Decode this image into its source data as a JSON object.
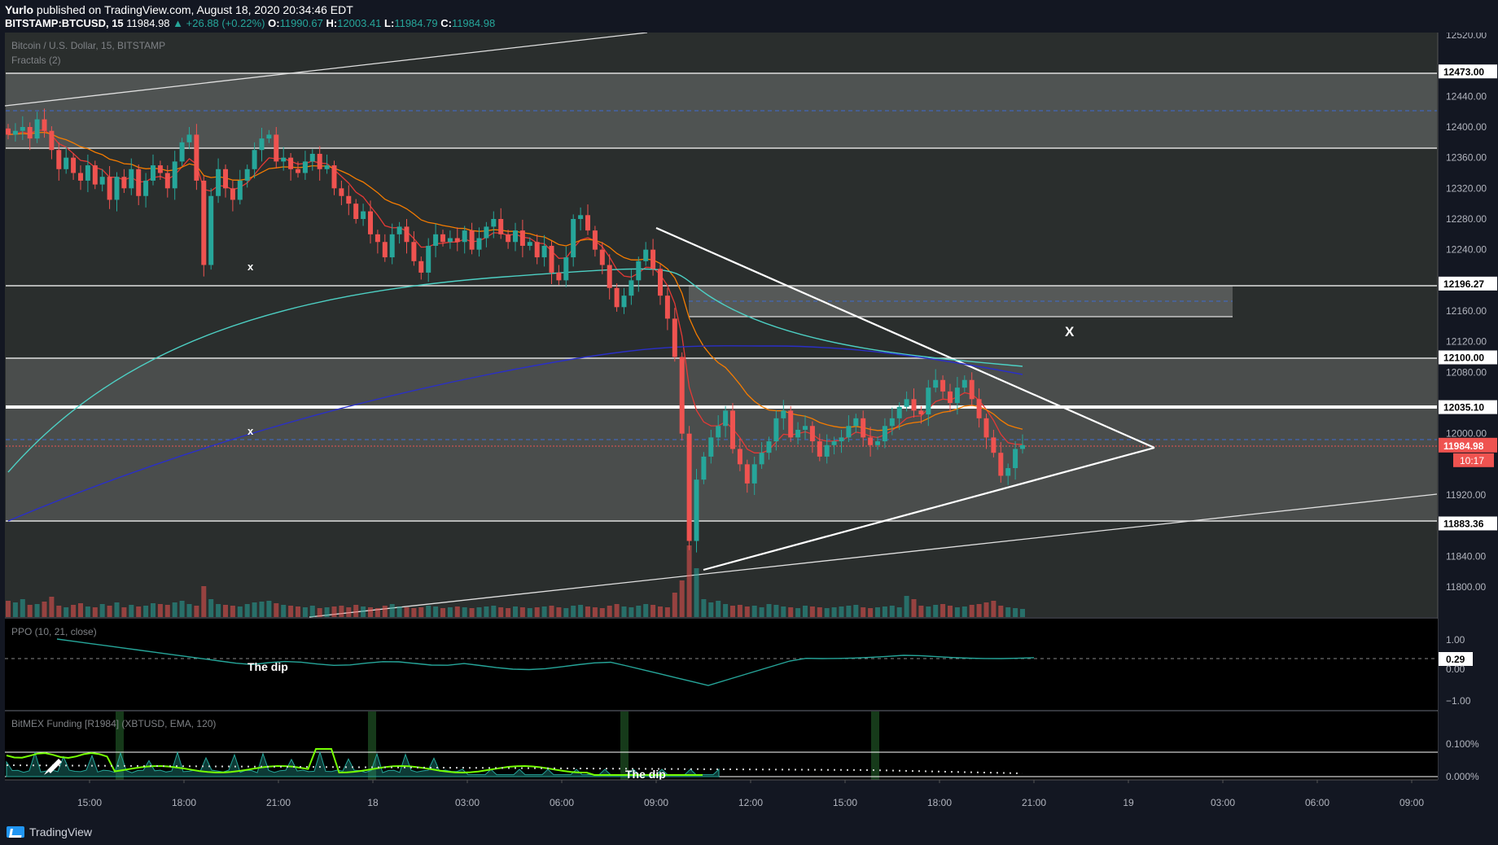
{
  "header": {
    "author": "Yurlo",
    "published_text": "published on TradingView.com, August 18, 2020 20:34:46 EDT",
    "symbol": "BITSTAMP:BTCUSD, 15",
    "last": "11984.98",
    "change": "▲ +26.88 (+0.22%)",
    "o_label": "O:",
    "o": "11990.67",
    "h_label": "H:",
    "h": "12003.41",
    "l_label": "L:",
    "l": "11984.79",
    "c_label": "C:",
    "c": "11984.98"
  },
  "legend": {
    "main": "Bitcoin / U.S. Dollar, 15, BITSTAMP",
    "fractals": "Fractals (2)",
    "ppo": "PPO (10, 21, close)",
    "funding": "BitMEX Funding [R1984] (XBTUSD, EMA, 120)"
  },
  "annotations": {
    "the_dip_1": "The dip",
    "the_dip_2": "The dip",
    "x_big": "X",
    "x_small_1": "x",
    "x_small_2": "x"
  },
  "footer": {
    "brand": "TradingView"
  },
  "colors": {
    "bg": "#131722",
    "up": "#26a69a",
    "down": "#ef5350",
    "zone": "#5d6062",
    "ema_red": "#e53935",
    "ema_orange": "#f57c00",
    "ema_teal": "#4dd0c4",
    "ema_blue": "#2a2fc8",
    "funding_green": "#76ff03"
  },
  "chart_data": [
    {
      "type": "candlestick",
      "title": "Bitcoin / U.S. Dollar, 15, BITSTAMP",
      "price_axis_ticks": [
        12520,
        12440,
        12400,
        12360,
        12320,
        12280,
        12240,
        12160,
        12120,
        12080,
        12000,
        11920,
        11840,
        11800
      ],
      "price_axis_tick_labels": [
        "12520.00",
        "12440.00",
        "12400.00",
        "12360.00",
        "12320.00",
        "12280.00",
        "12240.00",
        "12160.00",
        "12120.00",
        "12080.00",
        "12000.00",
        "11920.00",
        "11840.00",
        "11800.00"
      ],
      "ylim": [
        11770,
        12530
      ],
      "time_axis_labels": [
        "15:00",
        "18:00",
        "21:00",
        "18",
        "03:00",
        "06:00",
        "09:00",
        "12:00",
        "15:00",
        "18:00",
        "21:00",
        "19",
        "03:00",
        "06:00",
        "09:00"
      ],
      "horizontal_levels": [
        {
          "value": 12473.0,
          "label": "12473.00"
        },
        {
          "value": 12196.27,
          "label": "12196.27"
        },
        {
          "value": 12100.0,
          "label": "12100.00"
        },
        {
          "value": 12035.1,
          "label": "12035.10"
        },
        {
          "value": 11883.36,
          "label": "11883.36"
        }
      ],
      "last_price": {
        "value": 11984.98,
        "label": "11984.98",
        "countdown": "10:17"
      },
      "close_series": [
        12390,
        12395,
        12400,
        12385,
        12410,
        12395,
        12370,
        12345,
        12360,
        12340,
        12330,
        12350,
        12325,
        12335,
        12305,
        12335,
        12320,
        12345,
        12310,
        12330,
        12350,
        12340,
        12320,
        12355,
        12380,
        12390,
        12330,
        12220,
        12310,
        12345,
        12320,
        12305,
        12330,
        12345,
        12370,
        12385,
        12390,
        12355,
        12360,
        12345,
        12340,
        12355,
        12365,
        12345,
        12350,
        12320,
        12310,
        12300,
        12280,
        12290,
        12260,
        12250,
        12230,
        12260,
        12270,
        12250,
        12225,
        12210,
        12245,
        12260,
        12250,
        12255,
        12250,
        12265,
        12240,
        12255,
        12270,
        12280,
        12260,
        12250,
        12265,
        12245,
        12250,
        12230,
        12245,
        12210,
        12200,
        12230,
        12280,
        12285,
        12265,
        12240,
        12220,
        12190,
        12165,
        12180,
        12200,
        12225,
        12240,
        12215,
        12180,
        12150,
        12100,
        12000,
        11860,
        11940,
        11970,
        11995,
        12010,
        12030,
        11980,
        11960,
        11935,
        11960,
        11975,
        11990,
        12020,
        12030,
        11995,
        12005,
        12010,
        11990,
        11970,
        11985,
        11990,
        11995,
        12010,
        12020,
        11995,
        11985,
        11990,
        12010,
        12020,
        12035,
        12045,
        12030,
        12025,
        12060,
        12070,
        12055,
        12040,
        12060,
        12070,
        12045,
        12020,
        11995,
        11975,
        11945,
        11955,
        11980,
        11985
      ],
      "volume_series": [
        20,
        18,
        22,
        15,
        16,
        19,
        25,
        14,
        12,
        15,
        17,
        13,
        12,
        16,
        14,
        18,
        12,
        15,
        13,
        14,
        17,
        16,
        15,
        18,
        20,
        16,
        14,
        38,
        22,
        16,
        15,
        14,
        13,
        16,
        18,
        19,
        20,
        17,
        15,
        14,
        13,
        12,
        14,
        11,
        12,
        13,
        14,
        12,
        15,
        13,
        12,
        11,
        14,
        16,
        13,
        12,
        11,
        12,
        14,
        13,
        11,
        12,
        13,
        12,
        11,
        12,
        13,
        14,
        12,
        11,
        13,
        12,
        11,
        12,
        13,
        14,
        12,
        11,
        14,
        15,
        13,
        12,
        11,
        14,
        16,
        13,
        12,
        14,
        16,
        15,
        13,
        12,
        30,
        45,
        88,
        60,
        22,
        18,
        20,
        16,
        14,
        15,
        13,
        14,
        12,
        16,
        15,
        13,
        12,
        11,
        14,
        13,
        12,
        11,
        12,
        13,
        14,
        15,
        12,
        11,
        12,
        13,
        14,
        12,
        26,
        22,
        14,
        13,
        15,
        16,
        14,
        12,
        13,
        15,
        16,
        18,
        20,
        14,
        12,
        11,
        10,
        8,
        4
      ]
    },
    {
      "type": "line",
      "title": "PPO (10, 21, close)",
      "tick_labels": [
        "1.00",
        "0.29",
        "0.00",
        "−1.00"
      ],
      "current": 0.29,
      "ylim": [
        -1.5,
        1.5
      ]
    },
    {
      "type": "area",
      "title": "BitMEX Funding [R1984] (XBTUSD, EMA, 120)",
      "tick_labels": [
        "0.100%",
        "0.000%"
      ],
      "ylim": [
        -0.02,
        0.15
      ]
    }
  ]
}
